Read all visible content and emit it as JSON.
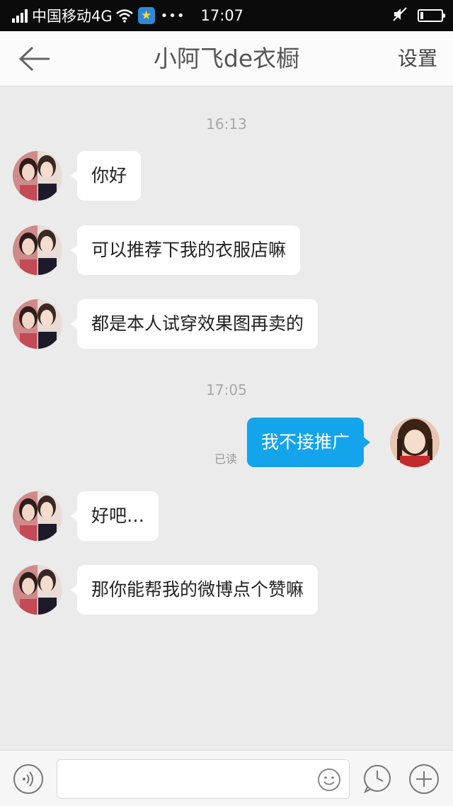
{
  "status_bar": {
    "carrier": "中国移动4G",
    "dots": "•••",
    "time": "17:07",
    "battery_level": 0.15
  },
  "nav": {
    "title": "小阿飞de衣橱",
    "settings_label": "设置"
  },
  "chat": {
    "timestamps": [
      "16:13",
      "17:05"
    ],
    "messages": [
      {
        "from": "contact",
        "text": "你好"
      },
      {
        "from": "contact",
        "text": "可以推荐下我的衣服店嘛"
      },
      {
        "from": "contact",
        "text": "都是本人试穿效果图再卖的"
      },
      {
        "from": "me",
        "text": "我不接推广",
        "status": "已读"
      },
      {
        "from": "contact",
        "text": "好吧…"
      },
      {
        "from": "contact",
        "text": "那你能帮我的微博点个赞嘛"
      }
    ]
  },
  "input_bar": {
    "placeholder": ""
  },
  "colors": {
    "outgoing_bubble": "#13a4ec",
    "incoming_bubble": "#ffffff",
    "background": "#ebebeb"
  },
  "icons": [
    "back-arrow-icon",
    "voice-icon",
    "emoji-icon",
    "clock-icon",
    "plus-icon",
    "star-icon",
    "wifi-icon",
    "mute-icon",
    "battery-icon",
    "signal-icon"
  ]
}
